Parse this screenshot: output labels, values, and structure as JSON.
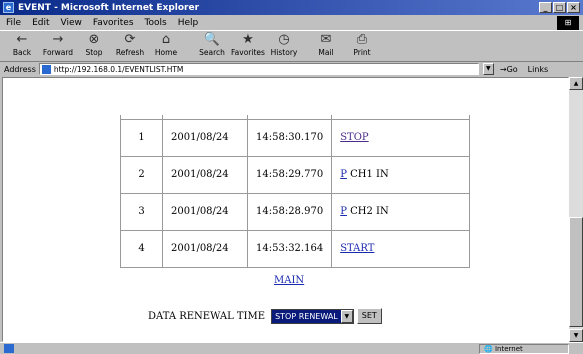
{
  "window": {
    "title": "EVENT - Microsoft Internet Explorer",
    "min": "_",
    "max": "□",
    "close": "×"
  },
  "menu": [
    "File",
    "Edit",
    "View",
    "Favorites",
    "Tools",
    "Help"
  ],
  "toolbar": [
    {
      "label": "Back",
      "icon": "←"
    },
    {
      "label": "Forward",
      "icon": "→"
    },
    {
      "label": "Stop",
      "icon": "⊗"
    },
    {
      "label": "Refresh",
      "icon": "⟳"
    },
    {
      "label": "Home",
      "icon": "⌂"
    },
    {
      "label": "Search",
      "icon": "🔍"
    },
    {
      "label": "Favorites",
      "icon": "★"
    },
    {
      "label": "History",
      "icon": "◷"
    },
    {
      "label": "Mail",
      "icon": "✉"
    },
    {
      "label": "Print",
      "icon": "⎙"
    }
  ],
  "address": {
    "label": "Address",
    "url": "http://192.168.0.1/EVENTLIST.HTM",
    "go": "Go",
    "links": "Links"
  },
  "events": [
    {
      "no": "1",
      "date": "2001/08/24",
      "time": "14:58:30.170",
      "link": "STOP",
      "suffix": ""
    },
    {
      "no": "2",
      "date": "2001/08/24",
      "time": "14:58:29.770",
      "link": "P",
      "suffix": " CH1 IN"
    },
    {
      "no": "3",
      "date": "2001/08/24",
      "time": "14:58:28.970",
      "link": "P",
      "suffix": " CH2 IN"
    },
    {
      "no": "4",
      "date": "2001/08/24",
      "time": "14:53:32.164",
      "link": "START",
      "suffix": ""
    }
  ],
  "main_link": "MAIN",
  "renewal": {
    "label": "DATA RENEWAL TIME",
    "selected": "STOP RENEWAL",
    "button": "SET"
  },
  "status": {
    "zone": "Internet"
  }
}
